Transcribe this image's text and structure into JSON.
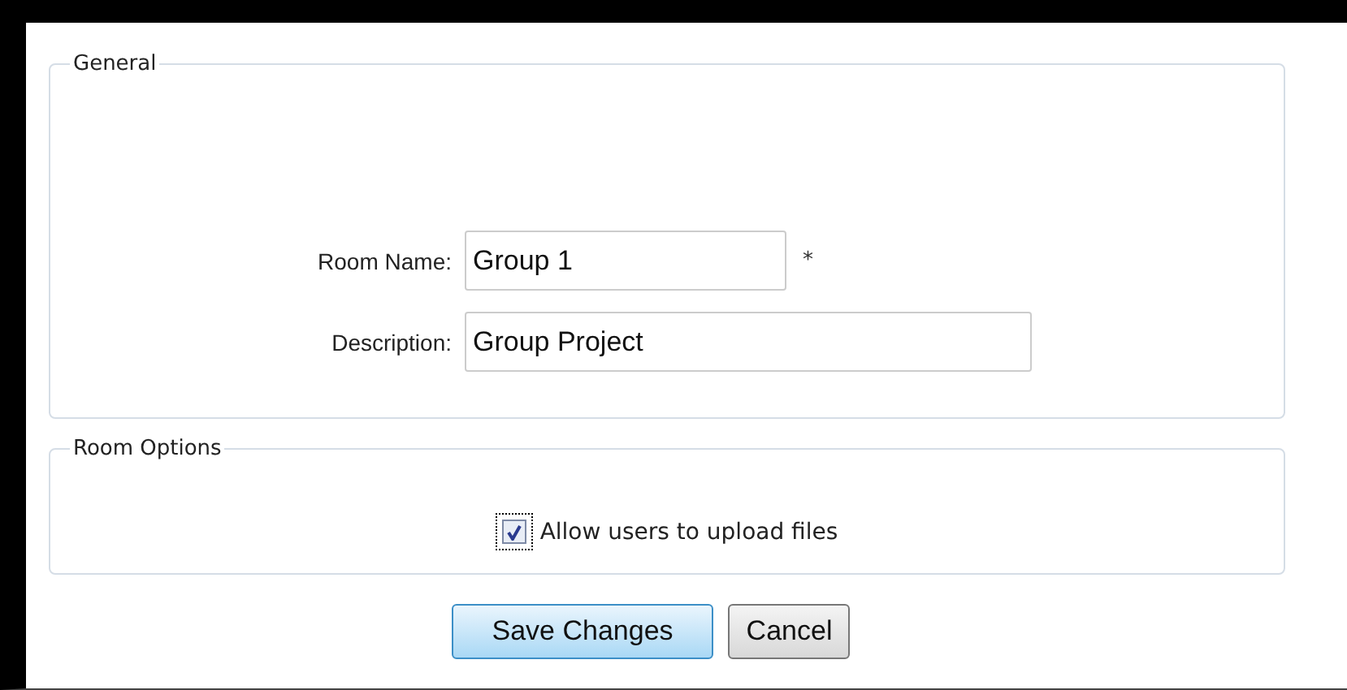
{
  "general": {
    "legend": "General",
    "fields": [
      {
        "label": "Room Name:",
        "value": "Group 1",
        "required_mark": "*"
      },
      {
        "label": "Description:",
        "value": "Group Project"
      }
    ]
  },
  "room_options": {
    "legend": "Room Options",
    "options": [
      {
        "label": "Allow users to upload files",
        "checked": true
      }
    ]
  },
  "buttons": [
    {
      "label": "Save Changes",
      "kind": "primary"
    },
    {
      "label": "Cancel",
      "kind": "secondary"
    }
  ]
}
